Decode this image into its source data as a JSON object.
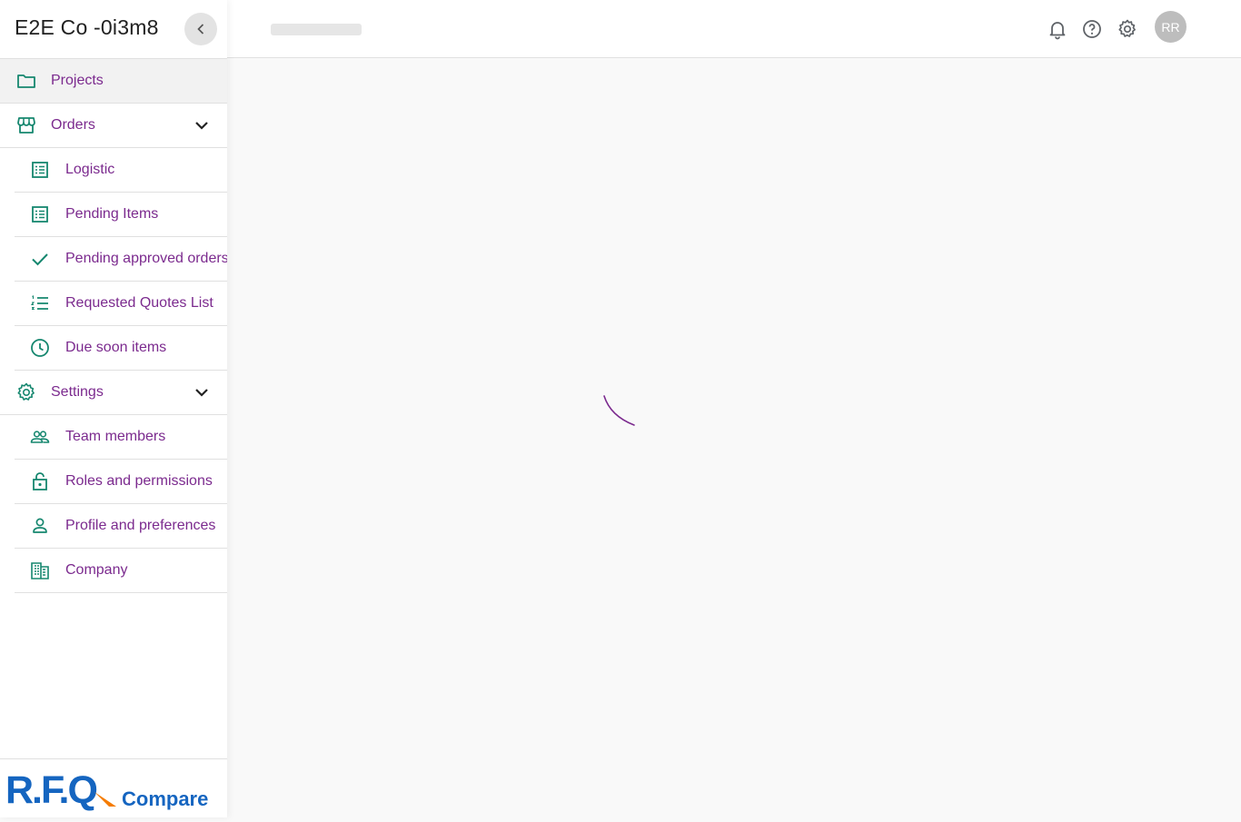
{
  "sidebar": {
    "company_name": "E2E Co -0i3m8",
    "items": [
      {
        "label": "Projects",
        "icon": "folder-icon",
        "active": true
      },
      {
        "label": "Orders",
        "icon": "store-icon",
        "expanded": true,
        "children": [
          {
            "label": "Logistic",
            "icon": "list-alt-icon"
          },
          {
            "label": "Pending Items",
            "icon": "list-alt-icon"
          },
          {
            "label": "Pending approved orders",
            "icon": "check-icon"
          },
          {
            "label": "Requested Quotes List",
            "icon": "format-list-numbered-icon"
          },
          {
            "label": "Due soon items",
            "icon": "clock-icon"
          }
        ]
      },
      {
        "label": "Settings",
        "icon": "gear-icon",
        "expanded": true,
        "children": [
          {
            "label": "Team members",
            "icon": "people-icon"
          },
          {
            "label": "Roles and permissions",
            "icon": "lock-open-icon"
          },
          {
            "label": "Profile and preferences",
            "icon": "person-icon"
          },
          {
            "label": "Company",
            "icon": "building-icon"
          }
        ]
      }
    ],
    "logo": {
      "primary": "R.F.Q",
      "secondary": "Compare"
    }
  },
  "topbar": {
    "icons": [
      "bell-icon",
      "help-icon",
      "gear-icon"
    ],
    "avatar_initials": "RR"
  },
  "colors": {
    "accent_text": "#7b2a8e",
    "icon_green": "#16876f",
    "logo_blue": "#1565c0",
    "logo_orange": "#f57c00"
  }
}
